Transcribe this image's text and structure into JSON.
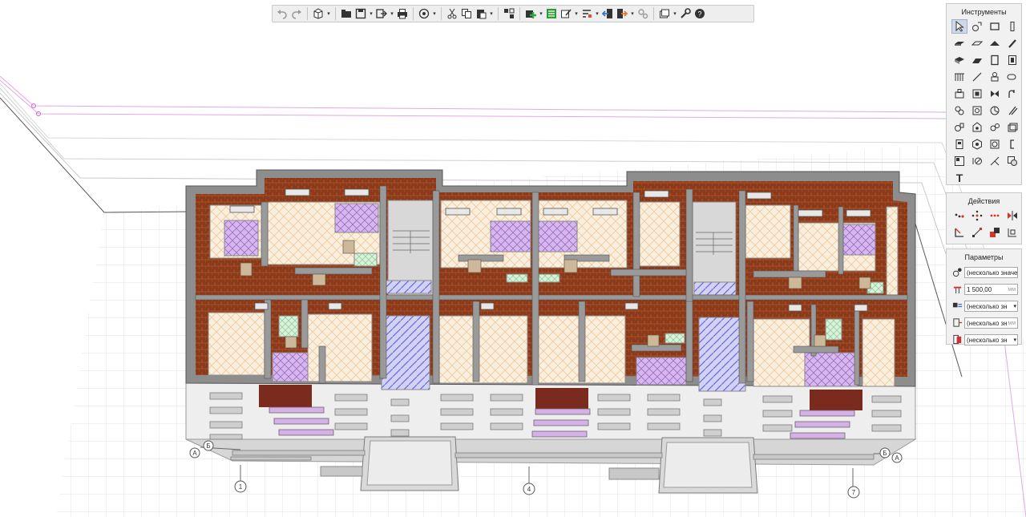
{
  "toolbar": {
    "items": [
      "undo-icon",
      "redo-icon",
      "view-cube-icon",
      "open-folder-icon",
      "save-icon",
      "export-icon",
      "print-icon",
      "orbit-icon",
      "cut-icon",
      "copy-icon",
      "paste-icon",
      "layers-icon",
      "add-element-icon",
      "list-icon",
      "material-icon",
      "level-icon",
      "import-icon",
      "export-arrow-icon",
      "gears-icon",
      "visibility-icon",
      "wrench-icon",
      "help-icon"
    ]
  },
  "panels": {
    "tools_title": "Инструменты",
    "actions_title": "Действия",
    "params_title": "Параметры",
    "tools_text_glyph": "T"
  },
  "params": {
    "row1_value": "(несколько значе",
    "row2_value": "1 500,00",
    "row2_unit": "мм",
    "row3_value": "(несколько зн",
    "row4_value": "(несколько зн",
    "row4_unit": "мм",
    "row5_value": "(несколько зн"
  },
  "axes": {
    "rows": [
      "Б",
      "А"
    ],
    "cols": [
      "1",
      "4",
      "7"
    ]
  },
  "colors": {
    "brick": "#8a3a1a",
    "floor": "#f7ecd9",
    "bath": "#c9a8e6",
    "lift": "#b9b9f2",
    "wall": "#888888",
    "facade": "#f0f0f0",
    "accent": "#3b73c7"
  }
}
